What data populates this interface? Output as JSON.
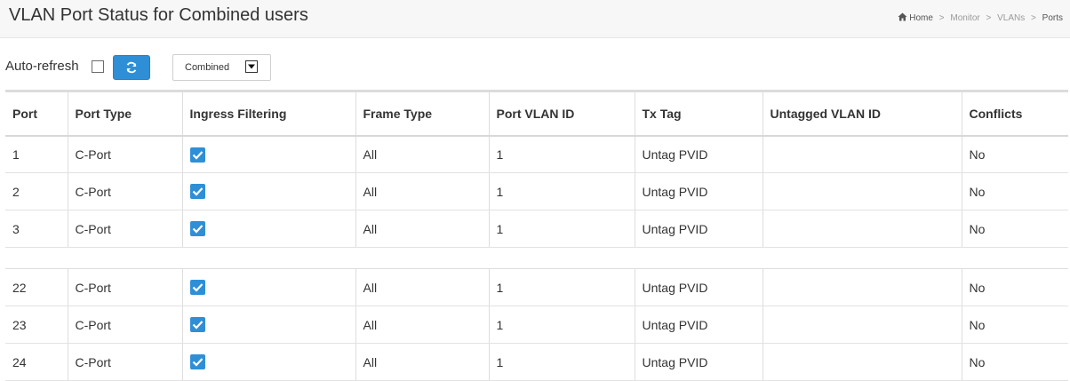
{
  "page": {
    "title": "VLAN Port Status for Combined users",
    "breadcrumb": {
      "home": "Home",
      "sep1": ">",
      "monitor": "Monitor",
      "sep2": ">",
      "vlans": "VLANs",
      "sep3": ">",
      "current": "Ports"
    }
  },
  "toolbar": {
    "auto_refresh_label": "Auto-refresh",
    "auto_refresh_checked": false,
    "refresh_icon": "refresh-icon",
    "user_select_value": "Combined"
  },
  "table": {
    "columns": [
      "Port",
      "Port Type",
      "Ingress Filtering",
      "Frame Type",
      "Port VLAN ID",
      "Tx Tag",
      "Untagged VLAN ID",
      "Conflicts"
    ],
    "rows_top": [
      {
        "port": "1",
        "port_type": "C-Port",
        "ingress_filtering": true,
        "frame_type": "All",
        "pvid": "1",
        "tx_tag": "Untag PVID",
        "untagged_vlan_id": "",
        "conflicts": "No"
      },
      {
        "port": "2",
        "port_type": "C-Port",
        "ingress_filtering": true,
        "frame_type": "All",
        "pvid": "1",
        "tx_tag": "Untag PVID",
        "untagged_vlan_id": "",
        "conflicts": "No"
      },
      {
        "port": "3",
        "port_type": "C-Port",
        "ingress_filtering": true,
        "frame_type": "All",
        "pvid": "1",
        "tx_tag": "Untag PVID",
        "untagged_vlan_id": "",
        "conflicts": "No"
      }
    ],
    "rows_bottom": [
      {
        "port": "22",
        "port_type": "C-Port",
        "ingress_filtering": true,
        "frame_type": "All",
        "pvid": "1",
        "tx_tag": "Untag PVID",
        "untagged_vlan_id": "",
        "conflicts": "No"
      },
      {
        "port": "23",
        "port_type": "C-Port",
        "ingress_filtering": true,
        "frame_type": "All",
        "pvid": "1",
        "tx_tag": "Untag PVID",
        "untagged_vlan_id": "",
        "conflicts": "No"
      },
      {
        "port": "24",
        "port_type": "C-Port",
        "ingress_filtering": true,
        "frame_type": "All",
        "pvid": "1",
        "tx_tag": "Untag PVID",
        "untagged_vlan_id": "",
        "conflicts": "No"
      }
    ]
  },
  "colors": {
    "accent": "#2f8fd6",
    "header_bg": "#f7f7f7",
    "border": "#dddddd"
  }
}
